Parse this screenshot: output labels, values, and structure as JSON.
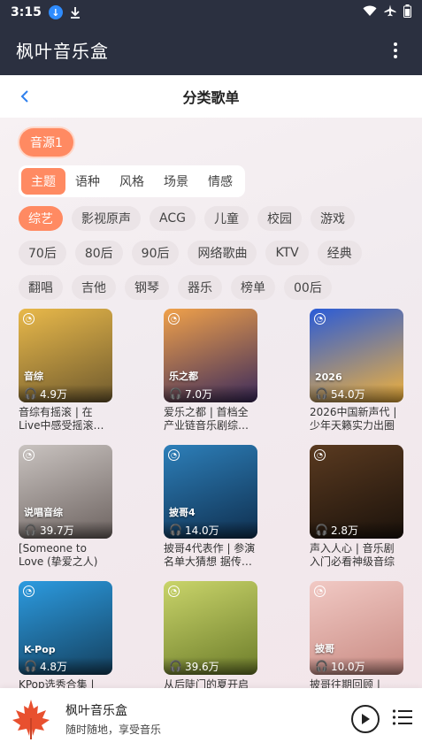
{
  "status_bar": {
    "time": "3:15"
  },
  "app_bar": {
    "title": "枫叶音乐盒"
  },
  "page_header": {
    "title": "分类歌单"
  },
  "source": {
    "label": "音源1"
  },
  "category_tabs": [
    {
      "label": "主题",
      "active": true
    },
    {
      "label": "语种",
      "active": false
    },
    {
      "label": "风格",
      "active": false
    },
    {
      "label": "场景",
      "active": false
    },
    {
      "label": "情感",
      "active": false
    }
  ],
  "tag_rows": [
    [
      {
        "label": "综艺",
        "active": true
      },
      {
        "label": "影视原声"
      },
      {
        "label": "ACG"
      },
      {
        "label": "儿童"
      },
      {
        "label": "校园"
      },
      {
        "label": "游戏"
      }
    ],
    [
      {
        "label": "70后"
      },
      {
        "label": "80后"
      },
      {
        "label": "90后"
      },
      {
        "label": "网络歌曲"
      },
      {
        "label": "KTV"
      },
      {
        "label": "经典"
      }
    ],
    [
      {
        "label": "翻唱"
      },
      {
        "label": "吉他"
      },
      {
        "label": "钢琴"
      },
      {
        "label": "器乐"
      },
      {
        "label": "榜单"
      },
      {
        "label": "00后"
      }
    ]
  ],
  "playlists": [
    {
      "tag": "音综",
      "plays": "4.9万",
      "desc": "音综有摇滚 | 在Live中感受摇滚…",
      "colors": [
        "#e9b94a",
        "#6f5a2e"
      ]
    },
    {
      "tag": "乐之都",
      "plays": "7.0万",
      "desc": "爱乐之都 | 首档全产业链音乐剧综…",
      "colors": [
        "#f0a14a",
        "#3b2a5c"
      ]
    },
    {
      "tag": "2026",
      "plays": "54.0万",
      "desc": "2026中国新声代 | 少年天籁实力出圈",
      "colors": [
        "#2a5bd7",
        "#f2b23a"
      ]
    },
    {
      "tag": "说唱音综",
      "plays": "39.7万",
      "desc": "[Someone to Love (挚爱之人) (Live)]…",
      "colors": [
        "#c9c3c0",
        "#6d6360"
      ]
    },
    {
      "tag": "披哥4",
      "plays": "14.0万",
      "desc": "披哥4代表作 | 参演名单大猜想 据传…",
      "colors": [
        "#2d7fb9",
        "#0f2f4f"
      ]
    },
    {
      "tag": "",
      "plays": "2.8万",
      "desc": "声入人心 | 音乐剧入门必看神级音综",
      "colors": [
        "#5a3a20",
        "#1b120b"
      ]
    },
    {
      "tag": "K-Pop",
      "plays": "4.8万",
      "desc": "KPop选秀合集 | 恭…",
      "colors": [
        "#2c9be0",
        "#14405e"
      ]
    },
    {
      "tag": "",
      "plays": "39.6万",
      "desc": "从后陡门的夏开启",
      "colors": [
        "#c9d46a",
        "#6d7d2a"
      ]
    },
    {
      "tag": "披哥",
      "plays": "10.0万",
      "desc": "披哥往期回顾 | 重…",
      "colors": [
        "#f1c9c4",
        "#c98b83"
      ]
    }
  ],
  "player": {
    "title": "枫叶音乐盒",
    "subtitle": "随时随地，享受音乐"
  },
  "colors": {
    "accent": "#ff8a62",
    "header": "#2b3040"
  }
}
